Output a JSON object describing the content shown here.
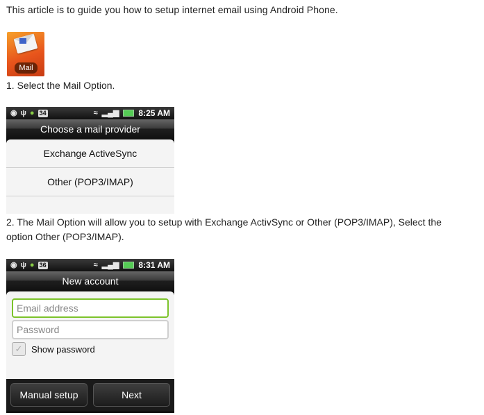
{
  "intro": "This article is to guide you how to setup internet email using Android Phone.",
  "mail_icon": {
    "label": "Mail"
  },
  "step1": "1. Select the Mail Option.",
  "step2_line1": "2. The Mail Option will allow you to setup with Exchange ActivSync or Other (POP3/IMAP), Select the",
  "step2_line2": "option Other (POP3/IMAP).",
  "screen1": {
    "status": {
      "badge": "34",
      "time": "8:25 AM"
    },
    "title": "Choose a mail provider",
    "options": [
      "Exchange ActiveSync",
      "Other (POP3/IMAP)"
    ]
  },
  "screen2": {
    "status": {
      "badge": "36",
      "time": "8:31 AM"
    },
    "title": "New account",
    "email_placeholder": "Email address",
    "password_placeholder": "Password",
    "show_password": "Show password",
    "manual_setup": "Manual setup",
    "next": "Next"
  }
}
